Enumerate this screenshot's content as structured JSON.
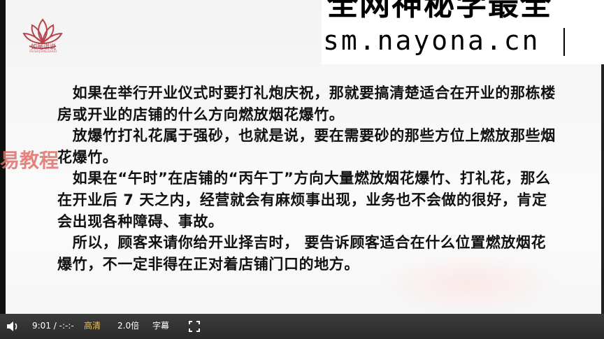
{
  "logo": {
    "name": "如是讲说",
    "subtitle": "RUSHIJIANGSHUO"
  },
  "watermark": {
    "line1": "全网神秘学最全",
    "line2": "sm.nayona.cn"
  },
  "side_watermark": "易教程",
  "content": {
    "paragraphs": [
      "如果在举行开业仪式时要打礼炮庆祝，那就要搞清楚适合在开业的那栋楼房或开业的店铺的什么方向燃放烟花爆竹。",
      "放爆竹打礼花属于强砂，也就是说，要在需要砂的那些方位上燃放那些烟花爆竹。",
      "如果在“午时”在店铺的“丙午丁”方向大量燃放烟花爆竹、打礼花，那么在开业后 7 天之内，经营就会有麻烦事出现，业务也不会做的很好，肯定会出现各种障碍、事故。",
      "所以，顾客来请你给开业择吉时， 要告诉顾客适合在什么位置燃放烟花爆竹，不一定非得在正对着店铺门口的地方。"
    ]
  },
  "player": {
    "volume_icon": "speaker-icon",
    "time": "9:01 / -:-:-",
    "quality": "高清",
    "speed": "2.0倍",
    "subtitles": "字幕",
    "fullscreen_icon": "fullscreen-icon",
    "accent_color": "#f2c14e"
  }
}
